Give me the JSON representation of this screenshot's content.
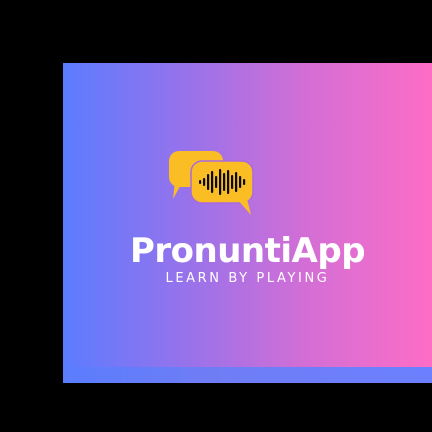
{
  "brand": {
    "name": "PronuntiApp",
    "tagline": "LEARN BY PLAYING",
    "logo_icon": "speech-bubbles-soundwave-icon"
  },
  "colors": {
    "background": "#000000",
    "gradient_start": "#5b7cff",
    "gradient_end": "#fd6dc6",
    "bubble_yellow": "#fbbd24",
    "wave_black": "#0b0b0b",
    "text": "#ffffff"
  }
}
